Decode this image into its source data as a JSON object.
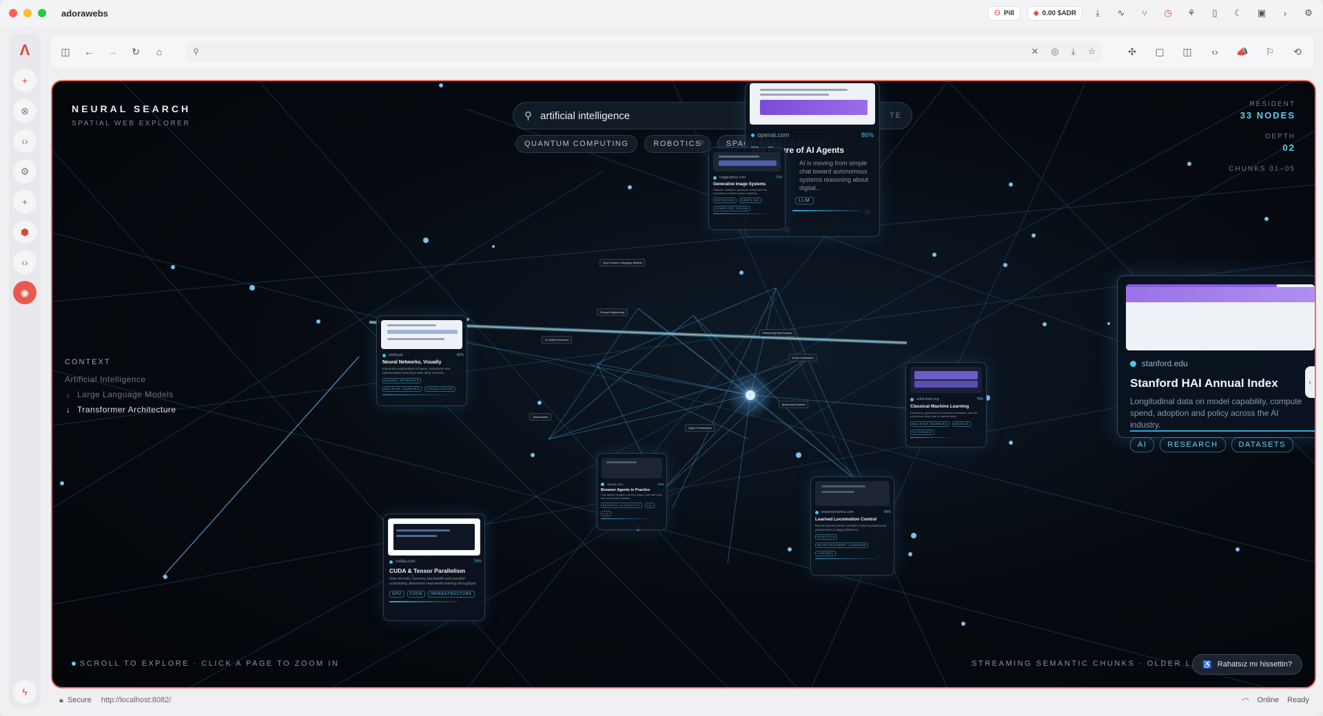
{
  "window": {
    "app_title": "adorawebs",
    "traffic": {
      "close": "#ff5f57",
      "minimize": "#febc2e",
      "zoom": "#28c840"
    }
  },
  "titlebar": {
    "pill_label": "Pill",
    "wallet": "0.00 $ADR",
    "icons": [
      "download-icon",
      "activity-icon",
      "branch-icon",
      "clock-icon",
      "network-icon",
      "book-icon",
      "moon-icon",
      "briefcase-icon",
      "chevron-right-icon",
      "gear-icon"
    ]
  },
  "sidebar": {
    "icons": [
      "logo-icon",
      "plus-icon",
      "close-circle-icon",
      "code-icon",
      "gear-icon",
      "add-icon",
      "cube-icon",
      "code-icon",
      "globe-icon"
    ],
    "bottom_icon": "bolt-icon"
  },
  "navbar": {
    "icons": [
      "sidebar-toggle-icon",
      "back-icon",
      "forward-icon",
      "reload-icon",
      "home-icon"
    ],
    "url_value": "",
    "url_end_icons": [
      "clear-icon",
      "shield-icon",
      "download-icon",
      "star-icon"
    ],
    "right_icons": [
      "puzzle-icon",
      "chat-icon",
      "split-icon",
      "code-icon",
      "megaphone-icon",
      "bookmark-icon",
      "history-icon"
    ]
  },
  "viewport": {
    "brand": {
      "title": "NEURAL SEARCH",
      "subtitle": "SPATIAL WEB EXPLORER"
    },
    "search": {
      "query": "artificial intelligence",
      "trailing": "TE"
    },
    "chips": [
      "QUANTUM COMPUTING",
      "ROBOTICS",
      "SPACE EXPLORATION"
    ],
    "stats": [
      {
        "label": "RESIDENT",
        "value": "33 NODES"
      },
      {
        "label": "DEPTH",
        "value": "02"
      },
      {
        "label": "CHUNKS 01–05",
        "value": ""
      }
    ],
    "context": {
      "heading": "CONTEXT",
      "items": [
        "Artificial Intelligence",
        "Large Language Models",
        "Transformer Architecture"
      ]
    },
    "hint": "SCROLL TO EXPLORE · CLICK A PAGE TO ZOOM IN",
    "stream": "STREAMING SEMANTIC CHUNKS · OLDER LAYE",
    "feedback": "Rahatsız mı hissettin?",
    "accent_color": "#5bd0f4"
  },
  "cards": {
    "openai": {
      "domain": "openai.com",
      "pct": "86%",
      "title": "The Future of AI Agents",
      "desc": "AI is moving from simple chat toward autonomous systems reasoning about digital...",
      "tags": [
        "LLM"
      ]
    },
    "genimg": {
      "domain": "huggingface.com",
      "pct": "71%",
      "title": "Generative Image Systems",
      "desc": "Diffusion samplers, guidance scales and the mechanics of latent space modeling.",
      "tags": [
        "DIFFUSION",
        "SAMPLING",
        "COMPUTER VISION"
      ]
    },
    "neural": {
      "domain": "distill.pub",
      "pct": "82%",
      "title": "Neural Networks, Visually",
      "desc": "Interactive explanations of layers, activations and representation learning inside deep networks.",
      "tags": [
        "NEURAL NETWORKS",
        "MACHINE LEARNING",
        "VISUALIZATION"
      ]
    },
    "classical": {
      "domain": "scikit-learn.org",
      "pct": "79%",
      "title": "Classical Machine Learning",
      "desc": "Estimators, pipelines and evaluation strategies that still outperform deep nets on tabular data.",
      "tags": [
        "MACHINE LEARNING",
        "MODELS",
        "TUTORIALS"
      ]
    },
    "browser": {
      "domain": "openai.com",
      "pct": "85%",
      "title": "Browser Agents in Practice",
      "desc": "How agents navigate real web pages, plan with tools and recover from failures.",
      "tags": [
        "BROWSER AUTOMATION",
        "AGI",
        "LLM"
      ]
    },
    "cuda": {
      "domain": "nvidia.com",
      "pct": "76%",
      "title": "CUDA & Tensor Parallelism",
      "desc": "How kernels, memory bandwidth and parallel scheduling determine real-world training throughput.",
      "tags": [
        "GPU",
        "CUDA",
        "INFRASTRUCTURE"
      ]
    },
    "locomotion": {
      "domain": "bostondynamics.com",
      "pct": "84%",
      "title": "Learned Locomotion Control",
      "desc": "Reinforcement learned controllers replacing hand-tuned gait planners on legged platforms.",
      "tags": [
        "ROBOTICS",
        "REINFORCEMENT LEARNING",
        "CONTROL"
      ]
    },
    "stanford": {
      "domain": "stanford.edu",
      "title": "Stanford HAI Annual Index",
      "desc": "Longitudinal data on model capability, compute spend, adoption and policy across the AI industry.",
      "tags": [
        "AI",
        "RESEARCH",
        "DATASETS"
      ],
      "thumb_url": "stanford.edu"
    }
  },
  "tiny_labels": [
    "Open Source Language Models",
    "Prompt Engineering",
    "AI Safety Research",
    "Reasoning Benchmarks",
    "Vector Databases",
    "Multimodal Models",
    "Tokenization",
    "Agent Frameworks"
  ],
  "statusbar": {
    "secure": "Secure",
    "url": "http://localhost:8082/",
    "online": "Online",
    "ready": "Ready"
  }
}
